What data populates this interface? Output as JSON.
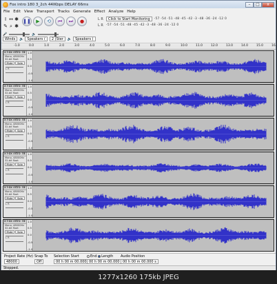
{
  "window": {
    "title": "Fox intro 180 3_2ch 44IKbps DELAY 66ms"
  },
  "menu": [
    "File",
    "Edit",
    "View",
    "Transport",
    "Tracks",
    "Generate",
    "Effect",
    "Analyze",
    "Help"
  ],
  "toolbar": {
    "tools": [
      "I",
      "↔",
      "✱",
      "✎",
      "⌕",
      "✱"
    ],
    "transport": [
      "❚❚",
      "▶",
      "⟲",
      "⏮",
      "⏭",
      "●"
    ],
    "monitor_label": "Click to Start Monitoring",
    "meter_scale": "-57 -54 -51 -48 -45 -42 -3  -48 -36 -24 -12  0",
    "lr_top": "L R",
    "lr_bottom": "L R",
    "host_label": "Winds",
    "output_device": "Speakers (",
    "channels": "2 (Ster",
    "input_device": "Speakers ("
  },
  "ruler": {
    "ticks": [
      "-1.0",
      "0.0",
      "1.0",
      "2.0",
      "3.0",
      "4.0",
      "5.0",
      "6.0",
      "7.0",
      "8.0",
      "9.0",
      "10.0",
      "11.0",
      "12.0",
      "13.0",
      "14.0",
      "15.0",
      "16.0"
    ]
  },
  "track_scale": [
    "1.0",
    "0.5",
    "0.0",
    "-0.5",
    "-1.0"
  ],
  "track_controls": {
    "mute": "Mute",
    "solo": "Solo",
    "lr": "L      R"
  },
  "tracks": [
    {
      "name": "Fox intro T8",
      "meta1": "Mono, 48000Hz",
      "meta2": "32-bit float",
      "amp": 0.55
    },
    {
      "name": "Fox intro T8",
      "meta1": "Mono, 48000Hz",
      "meta2": "32-bit float",
      "amp": 0.65
    },
    {
      "name": "Fox intro T8",
      "meta1": "Mono, 48000Hz",
      "meta2": "32-bit float",
      "amp": 0.7
    },
    {
      "name": "Fox intro T8",
      "meta1": "Mono, 48000Hz",
      "meta2": "32-bit float",
      "amp": 0.35
    },
    {
      "name": "Fox intro T8",
      "meta1": "Mono, 48000Hz",
      "meta2": "32-bit float",
      "amp": 0.6
    },
    {
      "name": "Fox intro T8",
      "meta1": "Mono, 48000Hz",
      "meta2": "32-bit float",
      "amp": 0.6
    }
  ],
  "colors": {
    "waveform": "#3232c8",
    "waveform_peak": "#6464dc"
  },
  "selection": {
    "project_rate_label": "Project Rate (Hz)",
    "project_rate_value": "48000",
    "snap_label": "Snap To",
    "snap_value": "Off",
    "start_label": "Selection Start",
    "start_value": "00 h 00 m 00.000 s",
    "end_label": "End",
    "length_label": "Length",
    "length_value": "00 h 00 m 00.000 s",
    "audio_position_label": "Audio Position",
    "audio_position_value": "00 h 00 m 00.000 s"
  },
  "status": "Stopped.",
  "caption": "1277x1260  175kb  JPEG"
}
